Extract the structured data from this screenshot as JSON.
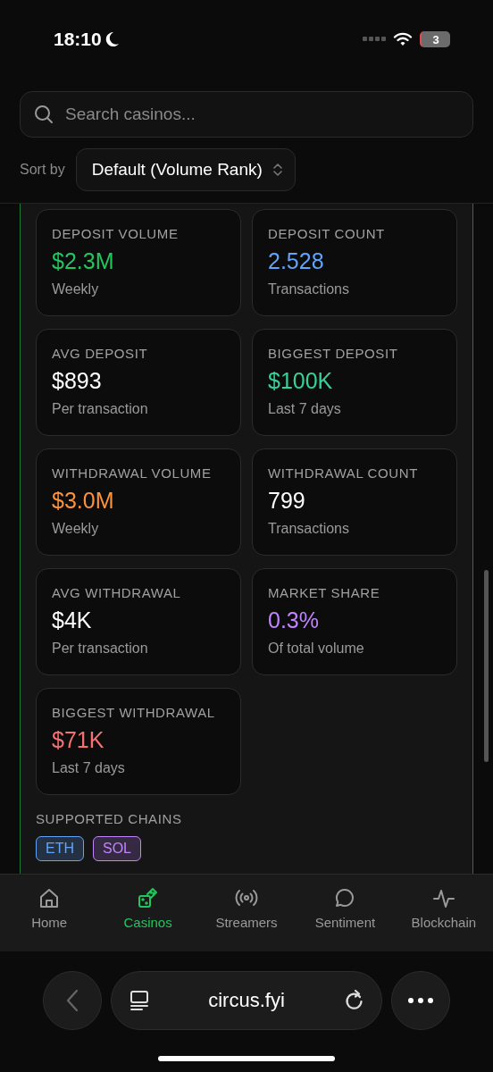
{
  "status_bar": {
    "time": "18:10",
    "battery": "3"
  },
  "search": {
    "placeholder": "Search casinos..."
  },
  "sort": {
    "label": "Sort by",
    "value": "Default (Volume Rank)"
  },
  "metrics": [
    {
      "label": "DEPOSIT VOLUME",
      "value": "$2.3M",
      "note": "Weekly",
      "color": "#22c55e"
    },
    {
      "label": "DEPOSIT COUNT",
      "value": "2.528",
      "note": "Transactions",
      "color": "#60a5fa"
    },
    {
      "label": "AVG DEPOSIT",
      "value": "$893",
      "note": "Per transaction",
      "color": "#ffffff"
    },
    {
      "label": "BIGGEST DEPOSIT",
      "value": "$100K",
      "note": "Last 7 days",
      "color": "#34d399"
    },
    {
      "label": "WITHDRAWAL VOLUME",
      "value": "$3.0M",
      "note": "Weekly",
      "color": "#fb923c"
    },
    {
      "label": "WITHDRAWAL COUNT",
      "value": "799",
      "note": "Transactions",
      "color": "#ffffff"
    },
    {
      "label": "AVG WITHDRAWAL",
      "value": "$4K",
      "note": "Per transaction",
      "color": "#ffffff"
    },
    {
      "label": "MARKET SHARE",
      "value": "0.3%",
      "note": "Of total volume",
      "color": "#c084fc"
    },
    {
      "label": "BIGGEST WITHDRAWAL",
      "value": "$71K",
      "note": "Last 7 days",
      "color": "#f87171"
    }
  ],
  "supported_chains": {
    "title": "SUPPORTED CHAINS",
    "chains": [
      {
        "label": "ETH",
        "color": "#60a5fa"
      },
      {
        "label": "SOL",
        "color": "#c084fc"
      }
    ]
  },
  "nav": [
    {
      "label": "Home",
      "selected": false
    },
    {
      "label": "Casinos",
      "selected": true
    },
    {
      "label": "Streamers",
      "selected": false
    },
    {
      "label": "Sentiment",
      "selected": false
    },
    {
      "label": "Blockchain",
      "selected": false
    }
  ],
  "browser": {
    "url": "circus.fyi"
  }
}
